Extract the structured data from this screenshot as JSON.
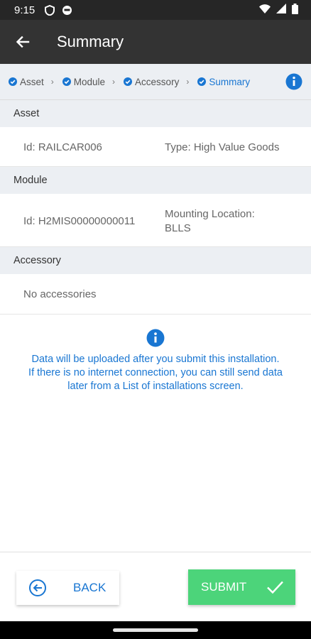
{
  "status_bar": {
    "time": "9:15",
    "icons": [
      "shield-icon",
      "face-icon",
      "wifi-icon",
      "signal-icon",
      "battery-icon"
    ]
  },
  "app_bar": {
    "title": "Summary",
    "back_icon": "arrow-left-icon"
  },
  "stepper": {
    "steps": [
      {
        "label": "Asset",
        "active": false
      },
      {
        "label": "Module",
        "active": false
      },
      {
        "label": "Accessory",
        "active": false
      },
      {
        "label": "Summary",
        "active": true
      }
    ],
    "info_icon": "info-icon",
    "accent": "#1976d2"
  },
  "sections": {
    "asset": {
      "header": "Asset",
      "id": "Id: RAILCAR006",
      "type": "Type: High Value Goods"
    },
    "module": {
      "header": "Module",
      "id": "Id: H2MIS00000000011",
      "mounting_line1": "Mounting Location:",
      "mounting_line2": "BLLS"
    },
    "accessory": {
      "header": "Accessory",
      "empty": "No accessories"
    }
  },
  "notice": {
    "line1": "Data will be uploaded after you submit this installation.",
    "line2": "If there is no internet connection, you can still send data",
    "line3": "later from a List of installations screen."
  },
  "buttons": {
    "back_label": "BACK",
    "submit_label": "SUBMIT",
    "submit_color": "#4cd47a"
  }
}
